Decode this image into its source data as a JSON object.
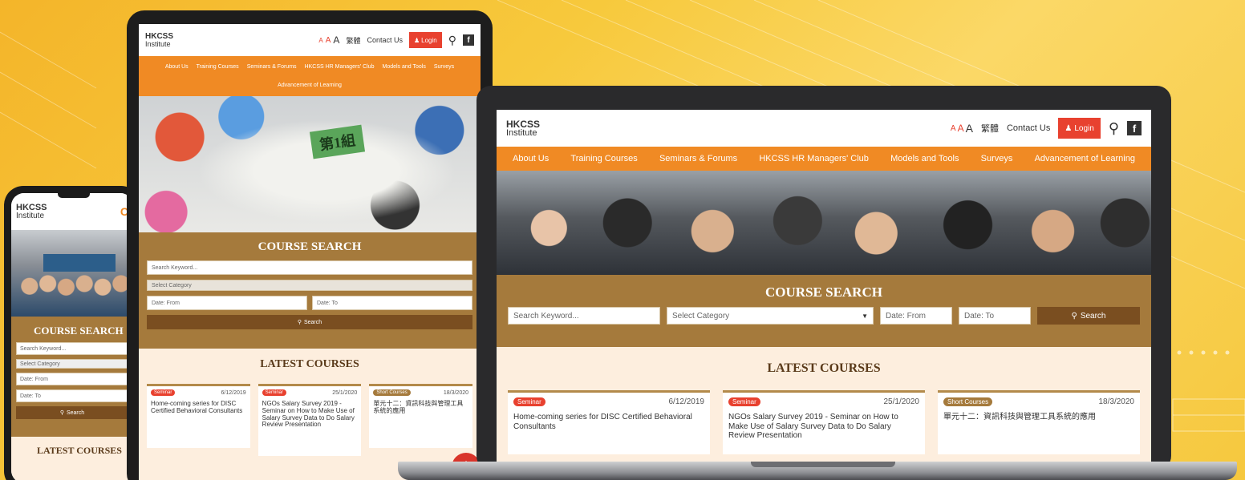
{
  "site": {
    "logo_line1": "HKCSS",
    "logo_line2": "Institute",
    "font_sizes": [
      "A",
      "A",
      "A"
    ],
    "lang_toggle": "繁體",
    "contact_label": "Contact Us",
    "login_label": "Login",
    "search_icon": "search-icon",
    "facebook_icon": "facebook-icon",
    "nav_items": [
      "About Us",
      "Training Courses",
      "Seminars & Forums",
      "HKCSS HR Managers' Club",
      "Models and Tools",
      "Surveys",
      "Advancement of Learning"
    ]
  },
  "course_search": {
    "title": "COURSE SEARCH",
    "keyword_placeholder": "Search Keyword...",
    "category_placeholder": "Select Category",
    "date_from_placeholder": "Date: From",
    "date_to_placeholder": "Date: To",
    "search_button": "Search",
    "phone_title": "COURSE SEARCH"
  },
  "latest_courses": {
    "title": "LATEST COURSES",
    "phone_title": "LATEST COURSES",
    "cards": [
      {
        "badge": "Seminar",
        "date": "6/12/2019",
        "title": "Home-coming series for DISC Certified Behavioral Consultants"
      },
      {
        "badge": "Seminar",
        "date": "25/1/2020",
        "title": "NGOs Salary Survey 2019 - Seminar on How to Make Use of Salary Survey Data to Do Salary Review Presentation"
      },
      {
        "badge": "Short Courses",
        "date": "18/3/2020",
        "title": "單元十二：資訊科技與管理工具系統的應用"
      }
    ]
  },
  "photo_sign": "第1組",
  "colors": {
    "orange_nav": "#f08a24",
    "brown_panel": "#a57a3c",
    "login_red": "#e8412f",
    "latest_bg": "#fdeede"
  }
}
